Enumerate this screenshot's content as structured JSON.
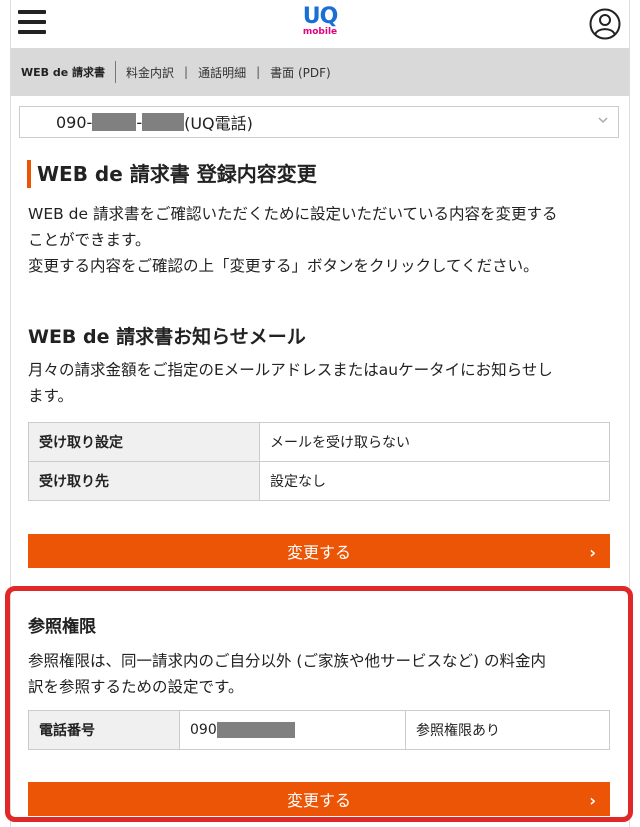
{
  "header": {
    "logo_main": "UQ",
    "logo_sub": "mobile"
  },
  "tabs": [
    {
      "label": "WEB de 請求書"
    },
    {
      "label": "料金内訳"
    },
    {
      "label": "通話明細"
    },
    {
      "label": "書面 (PDF)"
    }
  ],
  "line_select": {
    "number_prefix": "090-",
    "number_sep": "-",
    "line_label": "(UQ電話)"
  },
  "main": {
    "title": "WEB de 請求書 登録内容変更",
    "intro_line1": "WEB de 請求書をご確認いただくために設定いただいている内容を変更する",
    "intro_line2": "ことができます。",
    "intro_line3": "変更する内容をご確認の上「変更する」ボタンをクリックしてください。"
  },
  "notice_section": {
    "title": "WEB de 請求書お知らせメール",
    "desc_line1": "月々の請求金額をご指定のEメールアドレスまたはauケータイにお知らせし",
    "desc_line2": "ます。",
    "rows": [
      {
        "label": "受け取り設定",
        "value": "メールを受け取らない"
      },
      {
        "label": "受け取り先",
        "value": "設定なし"
      }
    ],
    "button_label": "変更する"
  },
  "permission_section": {
    "title": "参照権限",
    "desc_line1": "参照権限は、同一請求内のご自分以外 (ご家族や他サービスなど) の料金内",
    "desc_line2": "訳を参照するための設定です。",
    "row": {
      "label": "電話番号",
      "number_prefix": "090",
      "status": "参照権限あり"
    },
    "button_label": "変更する"
  },
  "colors": {
    "accent": "#eb5505",
    "highlight_border": "#e12828",
    "logo_blue": "#1a6fd4",
    "logo_pink": "#e4007f"
  }
}
